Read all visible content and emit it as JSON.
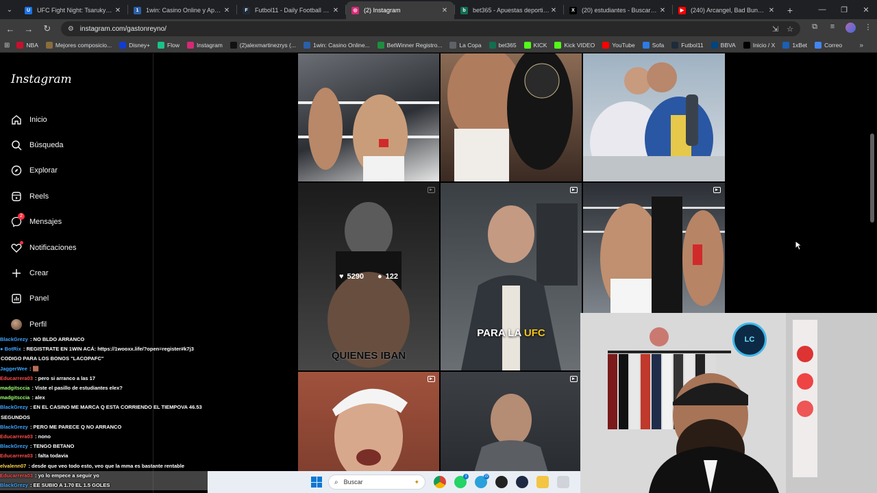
{
  "browser": {
    "tabs": [
      {
        "label": "UFC Fight Night: Tsarukyan vs.",
        "color": "#1a73e8",
        "glyph": "U",
        "active": false
      },
      {
        "label": "1win: Casino Online y Apuestas",
        "color": "#2b5fa8",
        "glyph": "1",
        "active": false
      },
      {
        "label": "Futbol11 - Daily Football Game",
        "color": "#1d2b3a",
        "glyph": "F",
        "active": false
      },
      {
        "label": "(2) Instagram",
        "color": "#d62976",
        "glyph": "◎",
        "active": true
      },
      {
        "label": "bet365 - Apuestas deportivas e",
        "color": "#126e51",
        "glyph": "b",
        "active": false
      },
      {
        "label": "(20) estudiantes - Buscar / X",
        "color": "#000000",
        "glyph": "X",
        "active": false
      },
      {
        "label": "(240) Arcangel, Bad Bunny - La",
        "color": "#ff0000",
        "glyph": "▶",
        "active": false
      }
    ],
    "url": "instagram.com/gastonreyno/",
    "bookmarks": [
      {
        "label": "NBA",
        "color": "#c8102e"
      },
      {
        "label": "Mejores composicio...",
        "color": "#8a6d3b"
      },
      {
        "label": "Disney+",
        "color": "#113ccf"
      },
      {
        "label": "Flow",
        "color": "#18c38a"
      },
      {
        "label": "Instagram",
        "color": "#d62976"
      },
      {
        "label": "(2)alexmartinezrys (...",
        "color": "#111111"
      },
      {
        "label": "1win: Casino Online...",
        "color": "#2b5fa8"
      },
      {
        "label": "BetWinner Registro...",
        "color": "#1c8f3f"
      },
      {
        "label": "La Copa",
        "color": "#5f6368"
      },
      {
        "label": "bet365",
        "color": "#126e51"
      },
      {
        "label": "KICK",
        "color": "#53fc18"
      },
      {
        "label": "Kick VIDEO",
        "color": "#53fc18"
      },
      {
        "label": "YouTube",
        "color": "#ff0000"
      },
      {
        "label": "Sofa",
        "color": "#2c7be5"
      },
      {
        "label": "Futbol11",
        "color": "#1d2b3a"
      },
      {
        "label": "BBVA",
        "color": "#004481"
      },
      {
        "label": "Inicio / X",
        "color": "#000000"
      },
      {
        "label": "1xBet",
        "color": "#1a5fb4"
      },
      {
        "label": "Correo",
        "color": "#4285f4"
      }
    ]
  },
  "instagram": {
    "logo": "Instagram",
    "nav": [
      {
        "key": "inicio",
        "label": "Inicio",
        "icon": "home-icon"
      },
      {
        "key": "busqueda",
        "label": "Búsqueda",
        "icon": "search-icon"
      },
      {
        "key": "explorar",
        "label": "Explorar",
        "icon": "compass-icon"
      },
      {
        "key": "reels",
        "label": "Reels",
        "icon": "reels-icon"
      },
      {
        "key": "mensajes",
        "label": "Mensajes",
        "icon": "messenger-icon",
        "badge": "2"
      },
      {
        "key": "notificaciones",
        "label": "Notificaciones",
        "icon": "heart-icon"
      },
      {
        "key": "crear",
        "label": "Crear",
        "icon": "plus-icon"
      },
      {
        "key": "panel",
        "label": "Panel",
        "icon": "dashboard-icon"
      },
      {
        "key": "perfil",
        "label": "Perfil",
        "icon": "avatar"
      }
    ],
    "posts": [
      {
        "kind": "photo",
        "video": false
      },
      {
        "kind": "photo",
        "video": false
      },
      {
        "kind": "photo",
        "video": false
      },
      {
        "kind": "reel",
        "video": true,
        "likes": "5290",
        "comments": "122",
        "caption": "QUIENES IBAN",
        "caption_hl": ""
      },
      {
        "kind": "reel",
        "video": true,
        "caption": "PARA LA ",
        "caption_hl": "UFC"
      },
      {
        "kind": "reel",
        "video": true
      },
      {
        "kind": "reel",
        "video": true
      },
      {
        "kind": "reel",
        "video": true
      }
    ]
  },
  "chat": [
    {
      "user": "BlackGrezy",
      "color": "#3ea6ff",
      "text": " : NO BLDO ARRANCO"
    },
    {
      "user": "● BotRix",
      "color": "#3ea6ff",
      "text": " : REGISTRATE EN 1WIN ACÁ: https://1wooxx.life/?open=register#k7j3"
    },
    {
      "user": "",
      "color": "#ffffff",
      "text": "CODIGO PARA LOS BONOS \"LACOPAFC\""
    },
    {
      "user": "JaggerWee",
      "color": "#3ea6ff",
      "text": " : 🟫"
    },
    {
      "user": "Educarrera03",
      "color": "#ff4d4d",
      "text": " : pero si arranco a las 17"
    },
    {
      "user": "madgitsccia",
      "color": "#9bff6b",
      "text": " : Viste el pasillo de estudiantes elex?"
    },
    {
      "user": "madgitsccia",
      "color": "#9bff6b",
      "text": " : alex"
    },
    {
      "user": "BlackGrezy",
      "color": "#3ea6ff",
      "text": " : EN EL CASINO ME MARCA Q ESTA CORRIENDO EL TIEMPOVA 46.53"
    },
    {
      "user": "",
      "color": "#ffffff",
      "text": "SEGUNDOS"
    },
    {
      "user": "BlackGrezy",
      "color": "#3ea6ff",
      "text": " : PERO ME PARECE Q NO ARRANCO"
    },
    {
      "user": "Educarrera03",
      "color": "#ff4d4d",
      "text": " : nono"
    },
    {
      "user": "BlackGrezy",
      "color": "#3ea6ff",
      "text": " : TENGO BETANO"
    },
    {
      "user": "Educarrera03",
      "color": "#ff4d4d",
      "text": " : falta todavia"
    },
    {
      "user": "elvalenn07",
      "color": "#ffd84d",
      "text": " : desde que veo todo esto, veo que la mma es bastante rentable"
    },
    {
      "user": "Educarrera03",
      "color": "#ff4d4d",
      "text": " : yo lo empece a seguir yo",
      "hl": true
    },
    {
      "user": "BlackGrezy",
      "color": "#3ea6ff",
      "text": " : EE SUBIO A 1.70 EL 1.5 GOLES",
      "hl": true
    }
  ],
  "taskbar": {
    "search_placeholder": "Buscar",
    "badges": {
      "whatsapp": "3",
      "telegram": "22"
    }
  }
}
